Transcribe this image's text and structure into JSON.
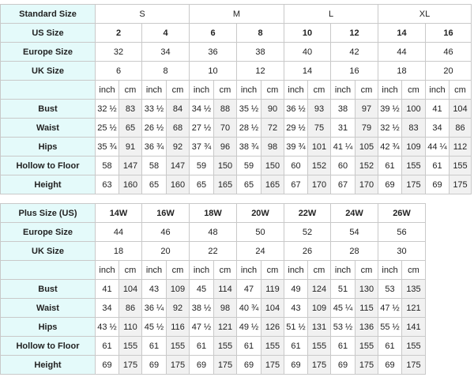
{
  "table1": {
    "size_header": "Standard Size",
    "size_groups": [
      "S",
      "M",
      "L",
      "XL"
    ],
    "us_label": "US Size",
    "us_sizes": [
      "2",
      "4",
      "6",
      "8",
      "10",
      "12",
      "14",
      "16"
    ],
    "europe_label": "Europe Size",
    "europe_sizes": [
      "32",
      "34",
      "36",
      "38",
      "40",
      "42",
      "44",
      "46"
    ],
    "uk_label": "UK Size",
    "uk_sizes": [
      "6",
      "8",
      "10",
      "12",
      "14",
      "16",
      "18",
      "20"
    ],
    "unit_inch": "inch",
    "unit_cm": "cm",
    "measurements": [
      {
        "label": "Bust",
        "values": [
          "32 ½",
          "83",
          "33 ½",
          "84",
          "34 ½",
          "88",
          "35 ½",
          "90",
          "36 ½",
          "93",
          "38",
          "97",
          "39 ½",
          "100",
          "41",
          "104"
        ]
      },
      {
        "label": "Waist",
        "values": [
          "25 ½",
          "65",
          "26 ½",
          "68",
          "27 ½",
          "70",
          "28 ½",
          "72",
          "29 ½",
          "75",
          "31",
          "79",
          "32 ½",
          "83",
          "34",
          "86"
        ]
      },
      {
        "label": "Hips",
        "values": [
          "35 ¾",
          "91",
          "36 ¾",
          "92",
          "37 ¾",
          "96",
          "38 ¾",
          "98",
          "39 ¾",
          "101",
          "41 ¼",
          "105",
          "42 ¾",
          "109",
          "44 ¼",
          "112"
        ]
      },
      {
        "label": "Hollow to Floor",
        "values": [
          "58",
          "147",
          "58",
          "147",
          "59",
          "150",
          "59",
          "150",
          "60",
          "152",
          "60",
          "152",
          "61",
          "155",
          "61",
          "155"
        ]
      },
      {
        "label": "Height",
        "values": [
          "63",
          "160",
          "65",
          "160",
          "65",
          "165",
          "65",
          "165",
          "67",
          "170",
          "67",
          "170",
          "69",
          "175",
          "69",
          "175"
        ]
      }
    ]
  },
  "table2": {
    "size_header": "Plus Size (US)",
    "us_sizes": [
      "14W",
      "16W",
      "18W",
      "20W",
      "22W",
      "24W",
      "26W"
    ],
    "europe_label": "Europe Size",
    "europe_sizes": [
      "44",
      "46",
      "48",
      "50",
      "52",
      "54",
      "56"
    ],
    "uk_label": "UK Size",
    "uk_sizes": [
      "18",
      "20",
      "22",
      "24",
      "26",
      "28",
      "30"
    ],
    "unit_inch": "inch",
    "unit_cm": "cm",
    "measurements": [
      {
        "label": "Bust",
        "values": [
          "41",
          "104",
          "43",
          "109",
          "45",
          "114",
          "47",
          "119",
          "49",
          "124",
          "51",
          "130",
          "53",
          "135"
        ]
      },
      {
        "label": "Waist",
        "values": [
          "34",
          "86",
          "36 ¼",
          "92",
          "38 ½",
          "98",
          "40 ¾",
          "104",
          "43",
          "109",
          "45 ¼",
          "115",
          "47 ½",
          "121"
        ]
      },
      {
        "label": "Hips",
        "values": [
          "43 ½",
          "110",
          "45 ½",
          "116",
          "47 ½",
          "121",
          "49 ½",
          "126",
          "51 ½",
          "131",
          "53 ½",
          "136",
          "55 ½",
          "141"
        ]
      },
      {
        "label": "Hollow to Floor",
        "values": [
          "61",
          "155",
          "61",
          "155",
          "61",
          "155",
          "61",
          "155",
          "61",
          "155",
          "61",
          "155",
          "61",
          "155"
        ]
      },
      {
        "label": "Height",
        "values": [
          "69",
          "175",
          "69",
          "175",
          "69",
          "175",
          "69",
          "175",
          "69",
          "175",
          "69",
          "175",
          "69",
          "175"
        ]
      }
    ]
  }
}
